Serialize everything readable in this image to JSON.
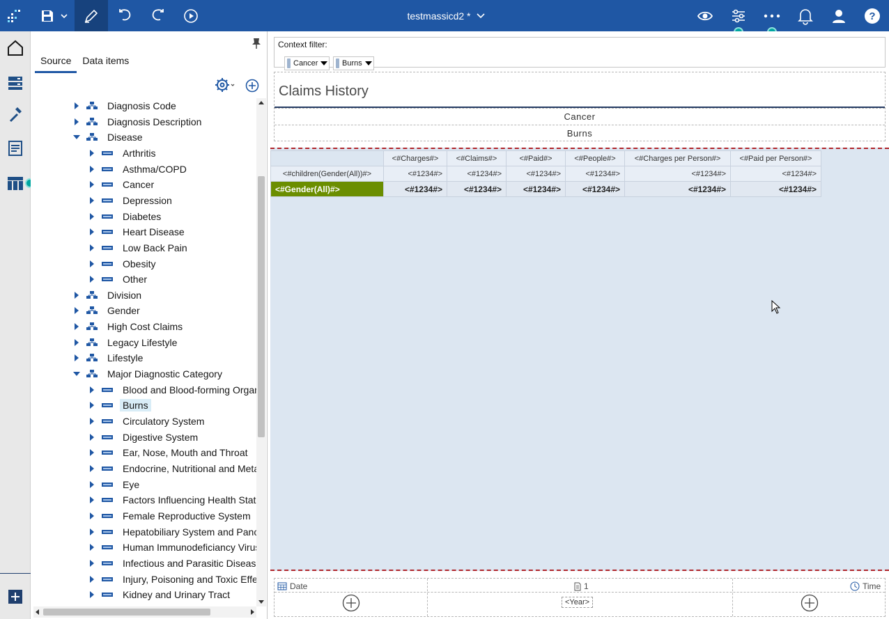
{
  "app": {
    "document_title": "testmassicd2 *"
  },
  "toolbar": {
    "icons": [
      "app-logo-icon",
      "save-icon",
      "chevron-down-icon",
      "edit-pencil-icon",
      "undo-icon",
      "redo-icon",
      "run-play-icon",
      "preview-eye-icon",
      "settings-sliders-icon",
      "more-dots-icon",
      "notifications-bell-icon",
      "user-icon",
      "help-icon"
    ]
  },
  "left_rail": {
    "items": [
      "home-icon",
      "data-sources-icon",
      "toolbox-hammer-icon",
      "pages-icon",
      "table-columns-icon"
    ]
  },
  "source_panel": {
    "tabs": [
      {
        "label": "Source",
        "active": true
      },
      {
        "label": "Data items",
        "active": false
      }
    ],
    "tree": [
      {
        "label": "Diagnosis Code",
        "level": 0,
        "type": "hierarchy",
        "expanded": false
      },
      {
        "label": "Diagnosis Description",
        "level": 0,
        "type": "hierarchy",
        "expanded": false
      },
      {
        "label": "Disease",
        "level": 0,
        "type": "hierarchy",
        "expanded": true
      },
      {
        "label": "Arthritis",
        "level": 1,
        "type": "member",
        "expanded": false
      },
      {
        "label": "Asthma/COPD",
        "level": 1,
        "type": "member",
        "expanded": false
      },
      {
        "label": "Cancer",
        "level": 1,
        "type": "member",
        "expanded": false
      },
      {
        "label": "Depression",
        "level": 1,
        "type": "member",
        "expanded": false
      },
      {
        "label": "Diabetes",
        "level": 1,
        "type": "member",
        "expanded": false
      },
      {
        "label": "Heart Disease",
        "level": 1,
        "type": "member",
        "expanded": false
      },
      {
        "label": "Low Back Pain",
        "level": 1,
        "type": "member",
        "expanded": false
      },
      {
        "label": "Obesity",
        "level": 1,
        "type": "member",
        "expanded": false
      },
      {
        "label": "Other",
        "level": 1,
        "type": "member",
        "expanded": false
      },
      {
        "label": "Division",
        "level": 0,
        "type": "hierarchy",
        "expanded": false
      },
      {
        "label": "Gender",
        "level": 0,
        "type": "hierarchy",
        "expanded": false
      },
      {
        "label": "High Cost Claims",
        "level": 0,
        "type": "hierarchy",
        "expanded": false
      },
      {
        "label": "Legacy Lifestyle",
        "level": 0,
        "type": "hierarchy",
        "expanded": false
      },
      {
        "label": "Lifestyle",
        "level": 0,
        "type": "hierarchy",
        "expanded": false
      },
      {
        "label": "Major Diagnostic Category",
        "level": 0,
        "type": "hierarchy",
        "expanded": true
      },
      {
        "label": "Blood and Blood-forming Organs",
        "level": 1,
        "type": "member",
        "expanded": false
      },
      {
        "label": "Burns",
        "level": 1,
        "type": "member",
        "expanded": false,
        "selected": true
      },
      {
        "label": "Circulatory System",
        "level": 1,
        "type": "member",
        "expanded": false
      },
      {
        "label": "Digestive System",
        "level": 1,
        "type": "member",
        "expanded": false
      },
      {
        "label": "Ear, Nose, Mouth and Throat",
        "level": 1,
        "type": "member",
        "expanded": false
      },
      {
        "label": "Endocrine, Nutritional and Metabo",
        "level": 1,
        "type": "member",
        "expanded": false
      },
      {
        "label": "Eye",
        "level": 1,
        "type": "member",
        "expanded": false
      },
      {
        "label": "Factors Influencing Health Status",
        "level": 1,
        "type": "member",
        "expanded": false
      },
      {
        "label": "Female Reproductive System",
        "level": 1,
        "type": "member",
        "expanded": false
      },
      {
        "label": "Hepatobiliary System and Pancre",
        "level": 1,
        "type": "member",
        "expanded": false
      },
      {
        "label": "Human Immunodeficiancy Virus I",
        "level": 1,
        "type": "member",
        "expanded": false
      },
      {
        "label": "Infectious and Parasitic Diseases",
        "level": 1,
        "type": "member",
        "expanded": false
      },
      {
        "label": "Injury, Poisoning and Toxic Effects",
        "level": 1,
        "type": "member",
        "expanded": false
      },
      {
        "label": "Kidney and Urinary Tract",
        "level": 1,
        "type": "member",
        "expanded": false
      }
    ]
  },
  "canvas": {
    "context_filter": {
      "label": "Context filter:",
      "chips": [
        "Cancer",
        "Burns"
      ]
    },
    "report_title": "Claims History",
    "header_rows": [
      "Cancer",
      "Burns"
    ],
    "crosstab": {
      "columns": [
        "<#Charges#>",
        "<#Claims#>",
        "<#Paid#>",
        "<#People#>",
        "<#Charges per Person#>",
        "<#Paid per Person#>"
      ],
      "rows": [
        {
          "label": "<#children(Gender(All))#>",
          "values": [
            "<#1234#>",
            "<#1234#>",
            "<#1234#>",
            "<#1234#>",
            "<#1234#>",
            "<#1234#>"
          ]
        },
        {
          "label": "<#Gender(All)#>",
          "values": [
            "<#1234#>",
            "<#1234#>",
            "<#1234#>",
            "<#1234#>",
            "<#1234#>",
            "<#1234#>"
          ]
        }
      ]
    },
    "footer": {
      "left_label": "Date",
      "center_label": "1",
      "right_label": "Time",
      "year_placeholder": "<Year>"
    }
  },
  "colors": {
    "topbar": "#1f57a4",
    "accent_teal": "#00a6a0",
    "summary_row_green": "#6b8e00",
    "body_fill": "#dce6f1",
    "section_border": "#b0242a"
  }
}
